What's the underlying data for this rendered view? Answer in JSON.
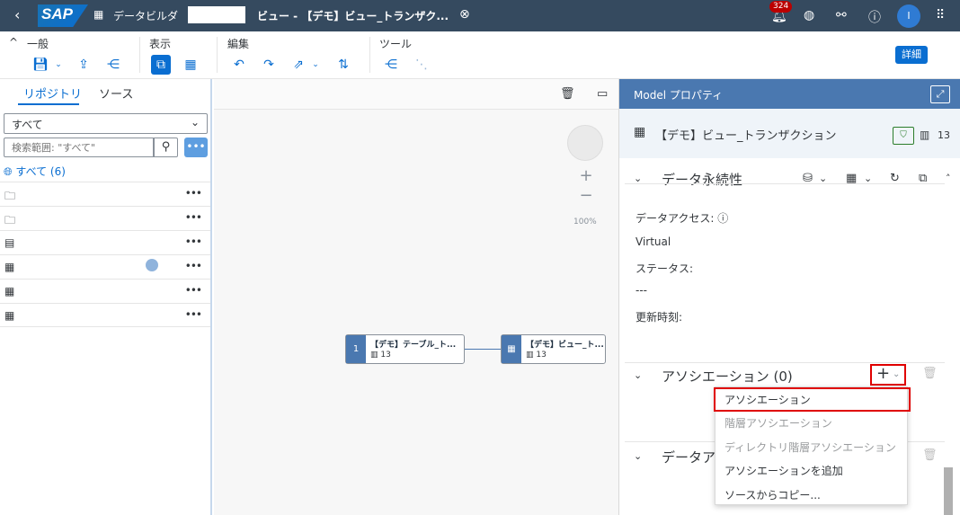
{
  "shell": {
    "app_name": "データビルダ",
    "breadcrumb": "ビュー - 【デモ】ビュー_トランザク...",
    "notification_count": "324",
    "avatar_initial": "I",
    "logo_text": "SAP"
  },
  "toolbar": {
    "groups": {
      "general": "一般",
      "view": "表示",
      "edit": "編集",
      "tools": "ツール"
    },
    "detail_label": "詳細"
  },
  "repository": {
    "tabs": [
      "リポジトリ",
      "ソース"
    ],
    "filter_value": "すべて",
    "search_placeholder": "検索範囲: \"すべて\"",
    "all_label": "すべて (6)"
  },
  "canvas": {
    "zoom": "100%",
    "nodes": [
      {
        "index": "1",
        "name": "【デモ】テーブル_ト...",
        "count": "13"
      },
      {
        "name": "【デモ】ビュー_ト...",
        "count": "13"
      }
    ]
  },
  "properties": {
    "header": "Model プロパティ",
    "object_name": "【デモ】ビュー_トランザクション",
    "object_count": "13",
    "persistence": {
      "title": "データ永続性",
      "data_access_label": "データアクセス:",
      "data_access_value": "Virtual",
      "status_label": "ステータス:",
      "status_value": "---",
      "updated_label": "更新時刻:"
    },
    "association": {
      "title": "アソシエーション (0)"
    },
    "data_section_title": "データア"
  },
  "menu": {
    "items": [
      {
        "label": "アソシエーション",
        "disabled": false
      },
      {
        "label": "階層アソシエーション",
        "disabled": true
      },
      {
        "label": "ディレクトリ階層アソシエーション",
        "disabled": true
      },
      {
        "label": "アソシエーションを追加",
        "disabled": false
      },
      {
        "label": "ソースからコピー...",
        "disabled": false
      }
    ]
  },
  "colors": {
    "shell_bg": "#354a5f",
    "accent": "#0a6ed1",
    "panel_header": "#4a78b0",
    "highlight": "#e00000"
  }
}
